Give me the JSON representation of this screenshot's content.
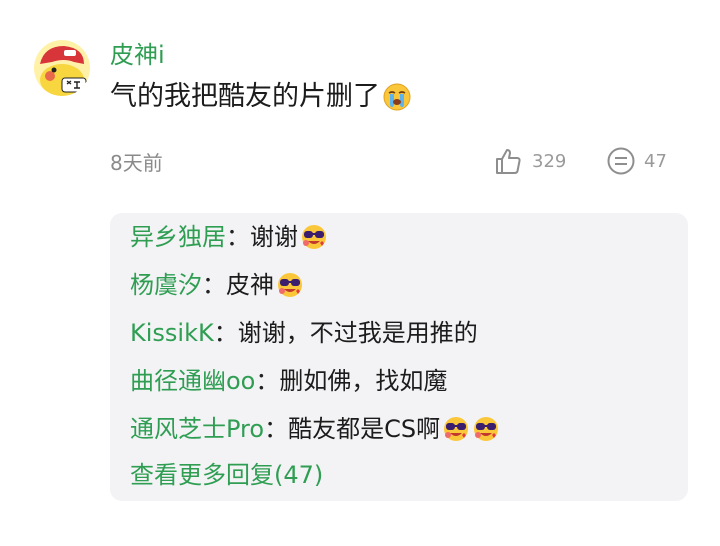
{
  "post": {
    "username": "皮神i",
    "content": "气的我把酷友的片删了",
    "content_emoji": "crying-face-emoji",
    "time": "8天前",
    "like_count": "329",
    "comment_count": "47"
  },
  "replies": [
    {
      "name": "异乡独居",
      "sep": "：",
      "text": "谢谢",
      "emojis": [
        "sunglasses-heart-eyes-emoji"
      ]
    },
    {
      "name": "杨虞汐",
      "sep": "：",
      "text": "皮神",
      "emojis": [
        "sunglasses-heart-eyes-emoji"
      ]
    },
    {
      "name": "KissikK",
      "sep": "：",
      "text": "谢谢，不过我是用推的",
      "emojis": []
    },
    {
      "name": "曲径通幽oo",
      "sep": "：",
      "text": "删如佛，找如魔",
      "emojis": []
    },
    {
      "name": "通风芝士Pro",
      "sep": "：",
      "text": "酷友都是CS啊",
      "emojis": [
        "sunglasses-heart-eyes-emoji",
        "sunglasses-heart-eyes-emoji"
      ]
    }
  ],
  "more_replies": "查看更多回复(47)",
  "colors": {
    "accent_green": "#2f9e53",
    "reply_background": "#f3f3f5",
    "meta_gray": "#8a8a8a"
  },
  "icons": {
    "like": "thumbs-up-icon",
    "comment": "comment-bubble-icon"
  }
}
